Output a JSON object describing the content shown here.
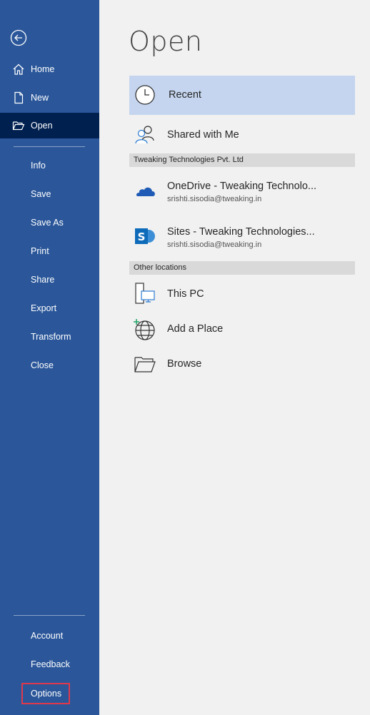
{
  "sidebar": {
    "back_icon": "back-arrow-icon",
    "items": [
      {
        "label": "Home",
        "icon": "home-icon"
      },
      {
        "label": "New",
        "icon": "new-document-icon"
      },
      {
        "label": "Open",
        "icon": "open-folder-icon",
        "active": true
      },
      {
        "label": "Info"
      },
      {
        "label": "Save"
      },
      {
        "label": "Save As"
      },
      {
        "label": "Print"
      },
      {
        "label": "Share"
      },
      {
        "label": "Export"
      },
      {
        "label": "Transform"
      },
      {
        "label": "Close"
      }
    ],
    "bottom_items": [
      {
        "label": "Account"
      },
      {
        "label": "Feedback"
      },
      {
        "label": "Options",
        "highlighted": true
      }
    ],
    "highlight_color": "#e0384a"
  },
  "main": {
    "title": "Open",
    "recent_label": "Recent",
    "shared_label": "Shared with Me",
    "section_org": "Tweaking Technologies Pvt. Ltd",
    "onedrive": {
      "label": "OneDrive - Tweaking Technolo...",
      "account": "srishti.sisodia@tweaking.in"
    },
    "sites": {
      "label": "Sites - Tweaking Technologies...",
      "account": "srishti.sisodia@tweaking.in"
    },
    "section_other": "Other locations",
    "this_pc_label": "This PC",
    "add_place_label": "Add a Place",
    "browse_label": "Browse"
  },
  "colors": {
    "sidebar_bg": "#2b579a",
    "active_bg": "#002050",
    "selected_bg": "#c5d5ef"
  }
}
